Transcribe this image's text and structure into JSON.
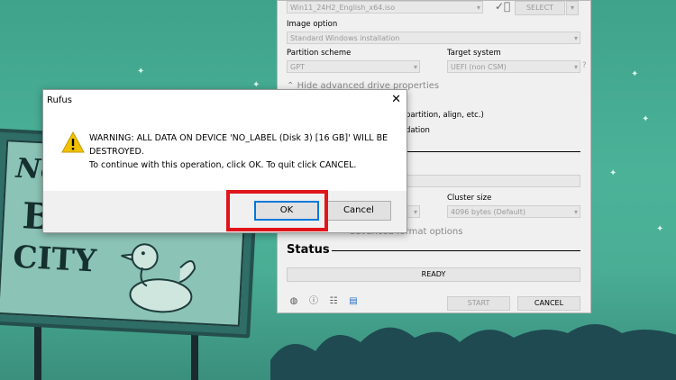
{
  "background": {
    "sign_lines": [
      "No",
      "B",
      "CITY"
    ]
  },
  "rufus": {
    "iso_file": "Win11_24H2_English_x64.iso",
    "select_button": "SELECT",
    "image_option_label": "Image option",
    "image_option_value": "Standard Windows installation",
    "partition_scheme_label": "Partition scheme",
    "partition_scheme_value": "GPT",
    "target_system_label": "Target system",
    "target_system_value": "UEFI (non CSM)",
    "help_mark": "?",
    "hide_advanced": "Hide advanced drive properties",
    "partial_option1": "partition, align, etc.)",
    "partial_option2": "dation",
    "cluster_size_label": "Cluster size",
    "cluster_size_value": "4096 bytes (Default)",
    "advanced_format": "advanced format options",
    "status_heading": "Status",
    "status_text": "READY",
    "start_button": "START",
    "cancel_button": "CANCEL"
  },
  "dialog": {
    "title": "Rufus",
    "close_glyph": "✕",
    "message_line1": "WARNING: ALL DATA ON DEVICE 'NO_LABEL (Disk 3) [16 GB]' WILL BE",
    "message_line2": "DESTROYED.",
    "message_line3": "To continue with this operation, click OK. To quit click CANCEL.",
    "ok_button": "OK",
    "cancel_button": "Cancel"
  },
  "colors": {
    "highlight": "#e0151c",
    "ok_focus": "#0078d7",
    "warning_icon": "#f2c200"
  }
}
